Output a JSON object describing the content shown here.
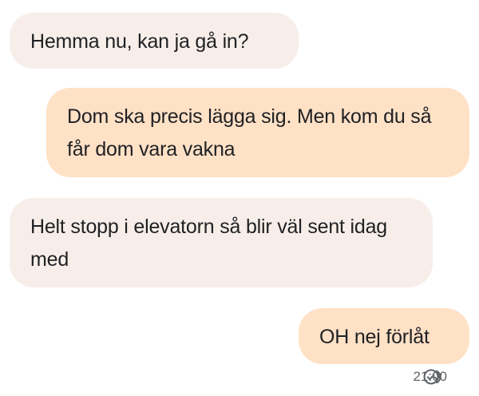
{
  "conversation": {
    "messages": [
      {
        "direction": "incoming",
        "text": "Hemma nu, kan ja gå in?"
      },
      {
        "direction": "outgoing",
        "text": "Dom ska precis lägga sig. Men kom du så får dom vara vakna"
      },
      {
        "direction": "incoming",
        "text": "Helt stopp i elevatorn så blir väl sent idag med"
      },
      {
        "direction": "outgoing",
        "text": "OH nej förlåt"
      }
    ],
    "last_message_status": {
      "time": "21:00",
      "icon": "read-receipt-icon"
    }
  },
  "colors": {
    "incoming_bubble": "#f7eee9",
    "outgoing_bubble": "#ffe1c6",
    "text": "#202124",
    "meta_text": "#5f6368"
  }
}
